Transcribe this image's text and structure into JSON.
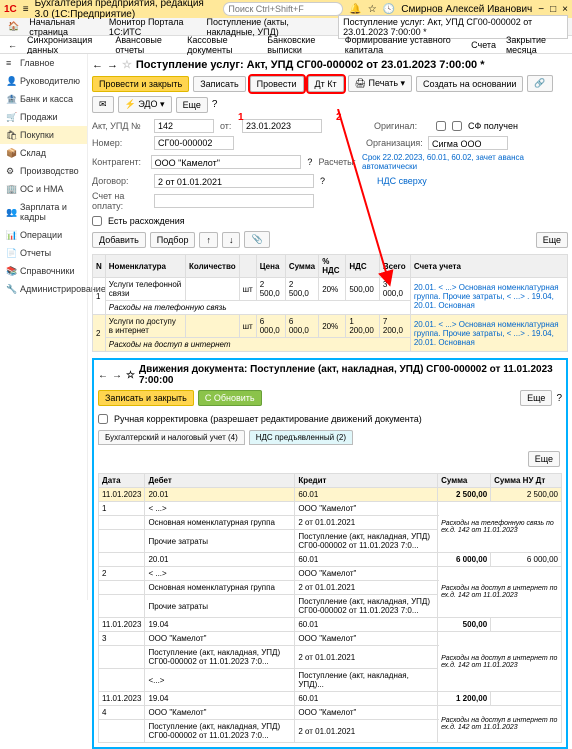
{
  "titlebar": {
    "app_title": "Бухгалтерия предприятия, редакция 3.0  (1С:Предприятие)",
    "search_placeholder": "Поиск Ctrl+Shift+F",
    "user": "Смирнов Алексей Иванович"
  },
  "breadcrumbs": {
    "home": "Начальная страница",
    "tab1": "Монитор Портала 1С:ИТС",
    "tab2": "Поступление (акты, накладные, УПД)",
    "tab3": "Поступление услуг: Акт, УПД СГ00-000002 от 23.01.2023 7:00:00 *"
  },
  "toolbar": {
    "sync": "Синхронизация данных",
    "advance": "Авансовые отчеты",
    "cash": "Кассовые документы",
    "bank": "Банковские выписки",
    "capital": "Формирование уставного капитала",
    "checks": "Счета",
    "close": "Закрытие месяца"
  },
  "sidebar": {
    "items": [
      {
        "ic": "≡",
        "label": "Главное"
      },
      {
        "ic": "👤",
        "label": "Руководителю"
      },
      {
        "ic": "🏦",
        "label": "Банк и касса"
      },
      {
        "ic": "🛒",
        "label": "Продажи"
      },
      {
        "ic": "🛍",
        "label": "Покупки"
      },
      {
        "ic": "📦",
        "label": "Склад"
      },
      {
        "ic": "⚙",
        "label": "Производство"
      },
      {
        "ic": "🏢",
        "label": "ОС и НМА"
      },
      {
        "ic": "👥",
        "label": "Зарплата и кадры"
      },
      {
        "ic": "📊",
        "label": "Операции"
      },
      {
        "ic": "📄",
        "label": "Отчеты"
      },
      {
        "ic": "📚",
        "label": "Справочники"
      },
      {
        "ic": "🔧",
        "label": "Администрирование"
      }
    ]
  },
  "doc": {
    "title": "Поступление услуг: Акт, УПД СГ00-000002 от 23.01.2023 7:00:00 *",
    "btn_post_close": "Провести и закрыть",
    "btn_save": "Записать",
    "btn_post": "Провести",
    "btn_print": "Печать",
    "btn_create_base": "Создать на основании",
    "btn_edo": "ЭДО",
    "btn_more": "Еще",
    "act_label": "Акт, УПД №",
    "act_no": "142",
    "act_date_label": "от:",
    "act_date": "23.01.2023",
    "original_label": "Оригинал:",
    "sf_received": "СФ получен",
    "number_label": "Номер:",
    "number": "СГ00-000002",
    "org_label": "Организация:",
    "org": "Сигма ООО",
    "contr_label": "Контрагент:",
    "contr": "ООО \"Камелот\"",
    "calc_label": "Расчеты:",
    "calc_link": "Срок 22.02.2023, 60.01, 60.02, зачет аванса автоматически",
    "dogovor_label": "Договор:",
    "dogovor": "2 от 01.01.2021",
    "nds_label": "НДС сверху",
    "acct_label": "Счет на оплату:",
    "discrepancy": "Есть расхождения",
    "add": "Добавить",
    "pick": "Подбор",
    "table": {
      "cols": [
        "N",
        "Номенклатура",
        "Количество",
        "",
        "Цена",
        "Сумма",
        "% НДС",
        "НДС",
        "Всего",
        "Счета учета"
      ],
      "row1": {
        "n": "1",
        "nom": "Услуги телефонной связи",
        "unit": "шт",
        "price": "2 500,0",
        "sum": "2 500,0",
        "ndsp": "20%",
        "nds": "500,00",
        "total": "3 000,0",
        "acc": "20.01. < ...> Основная номенклатурная группа. Прочие затраты, < ...> . 19.04, 20.01. Основная"
      },
      "row1sub": "Расходы на телефонную связь",
      "row2": {
        "n": "2",
        "nom": "Услуги по доступу в интернет",
        "unit": "шт",
        "price": "6 000,0",
        "sum": "6 000,0",
        "ndsp": "20%",
        "nds": "1 200,00",
        "total": "7 200,0",
        "acc": "20.01. < ...> Основная номенклатурная группа. Прочие затраты, < ...> . 19.04, 20.01. Основная"
      },
      "row2sub": "Расходы на доступ в интернет"
    }
  },
  "panel2": {
    "title": "Движения документа: Поступление (акт, накладная, УПД) СГ00-000002 от 11.01.2023 7:00:00",
    "btn_save_close": "Записать и закрыть",
    "btn_refresh": "Обновить",
    "btn_more": "Еще",
    "manual_corr": "Ручная корректировка (разрешает редактирование движений документа)",
    "tab1": "Бухгалтерский и налоговый учет (4)",
    "tab2": "НДС предъявленный (2)",
    "cols": [
      "Дата",
      "Дебет",
      "",
      "",
      "Кредит",
      "",
      "Сумма",
      "Сумма НУ Дт"
    ],
    "rows": [
      {
        "date": "11.01.2023",
        "dt": "20.01",
        "kt": "60.01",
        "sum": "2 500,00",
        "sumnu": "2 500,00",
        "dtsub1": "< ...>",
        "ktsub1": "ООО \"Камелот\"",
        "desc": "Расходы на телефонную связь по ех.д. 142 от 11.01.2023",
        "dtsub2": "Основная номенклатурная группа",
        "ktsub2": "2 от 01.01.2021",
        "dtsub3": "Прочие затраты",
        "ktsub3": "Поступление (акт, накладная, УПД) СГ00-000002 от 11.01.2023 7:0..."
      },
      {
        "date": "",
        "dt": "20.01",
        "kt": "60.01",
        "sum": "6 000,00",
        "sumnu": "6 000,00",
        "n": "2",
        "dtsub1": "< ...>",
        "ktsub1": "ООО \"Камелот\"",
        "desc": "Расходы на доступ в интернет по ех.д. 142 от 11.01.2023",
        "dtsub2": "Основная номенклатурная группа",
        "ktsub2": "2 от 01.01.2021",
        "dtsub3": "Прочие затраты",
        "ktsub3": "Поступление (акт, накладная, УПД) СГ00-000002 от 11.01.2023 7:0..."
      },
      {
        "date": "11.01.2023",
        "dt": "19.04",
        "kt": "60.01",
        "sum": "500,00",
        "n": "3",
        "dtsub1": "ООО \"Камелот\"",
        "ktsub1": "ООО \"Камелот\"",
        "desc": "Расходы на доступ в интернет по ех.д. 142 от 11.01.2023",
        "dtsub2": "Поступление (акт, накладная, УПД) СГ00-000002 от 11.01.2023 7:0...",
        "ktsub2": "2 от 01.01.2021",
        "ktsub3": "Поступление (акт, накладная, УПД)..."
      },
      {
        "date": "11.01.2023",
        "dt": "19.04",
        "kt": "60.01",
        "sum": "1 200,00",
        "n": "4",
        "dtsub1": "ООО \"Камелот\"",
        "ktsub1": "ООО \"Камелот\"",
        "desc": "Расходы на доступ в интернет по ех.д. 142 от 11.01.2023",
        "dtsub2": "Поступление (акт, накладная, УПД) СГ00-000002 от 11.01.2023 7:0...",
        "ktsub2": "2 от 01.01.2021"
      }
    ]
  },
  "callouts": {
    "c1": "1",
    "c2": "2"
  }
}
